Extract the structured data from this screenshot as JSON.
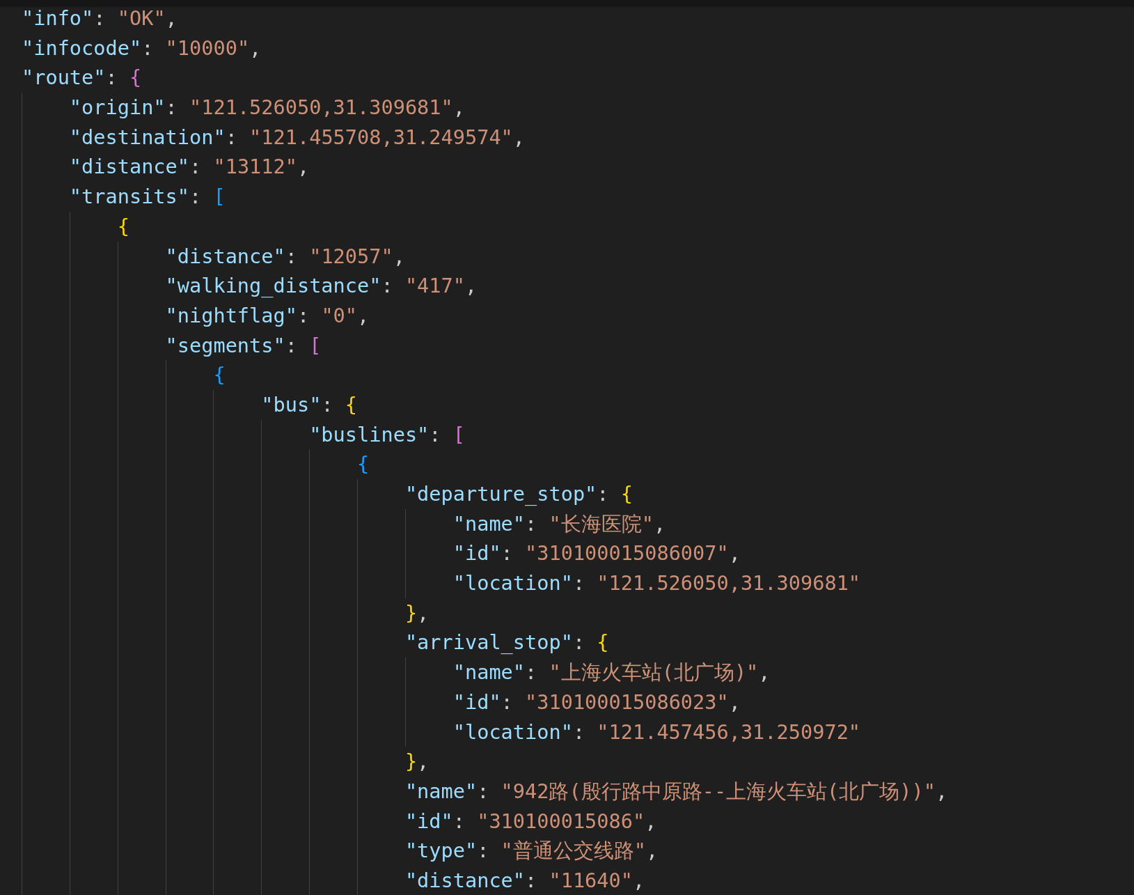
{
  "editor": {
    "lines": [
      {
        "tokens": [
          {
            "kind": "key",
            "text": "\"info\""
          },
          {
            "kind": "punct",
            "text": ": "
          },
          {
            "kind": "string",
            "text": "\"OK\""
          },
          {
            "kind": "punct",
            "text": ","
          }
        ]
      },
      {
        "tokens": [
          {
            "kind": "key",
            "text": "\"infocode\""
          },
          {
            "kind": "punct",
            "text": ": "
          },
          {
            "kind": "string",
            "text": "\"10000\""
          },
          {
            "kind": "punct",
            "text": ","
          }
        ]
      },
      {
        "tokens": [
          {
            "kind": "key",
            "text": "\"route\""
          },
          {
            "kind": "punct",
            "text": ": "
          },
          {
            "kind": "bracket",
            "text": "{",
            "color": "#da70d6"
          }
        ],
        "children": [
          {
            "tokens": [
              {
                "kind": "key",
                "text": "\"origin\""
              },
              {
                "kind": "punct",
                "text": ": "
              },
              {
                "kind": "string",
                "text": "\"121.526050,31.309681\""
              },
              {
                "kind": "punct",
                "text": ","
              }
            ]
          },
          {
            "tokens": [
              {
                "kind": "key",
                "text": "\"destination\""
              },
              {
                "kind": "punct",
                "text": ": "
              },
              {
                "kind": "string",
                "text": "\"121.455708,31.249574\""
              },
              {
                "kind": "punct",
                "text": ","
              }
            ]
          },
          {
            "tokens": [
              {
                "kind": "key",
                "text": "\"distance\""
              },
              {
                "kind": "punct",
                "text": ": "
              },
              {
                "kind": "string",
                "text": "\"13112\""
              },
              {
                "kind": "punct",
                "text": ","
              }
            ]
          },
          {
            "tokens": [
              {
                "kind": "key",
                "text": "\"transits\""
              },
              {
                "kind": "punct",
                "text": ": "
              },
              {
                "kind": "bracket",
                "text": "[",
                "color": "#179fff"
              }
            ],
            "children": [
              {
                "tokens": [
                  {
                    "kind": "bracket",
                    "text": "{",
                    "color": "#ffd700"
                  }
                ],
                "children": [
                  {
                    "tokens": [
                      {
                        "kind": "key",
                        "text": "\"distance\""
                      },
                      {
                        "kind": "punct",
                        "text": ": "
                      },
                      {
                        "kind": "string",
                        "text": "\"12057\""
                      },
                      {
                        "kind": "punct",
                        "text": ","
                      }
                    ]
                  },
                  {
                    "tokens": [
                      {
                        "kind": "key",
                        "text": "\"walking_distance\""
                      },
                      {
                        "kind": "punct",
                        "text": ": "
                      },
                      {
                        "kind": "string",
                        "text": "\"417\""
                      },
                      {
                        "kind": "punct",
                        "text": ","
                      }
                    ]
                  },
                  {
                    "tokens": [
                      {
                        "kind": "key",
                        "text": "\"nightflag\""
                      },
                      {
                        "kind": "punct",
                        "text": ": "
                      },
                      {
                        "kind": "string",
                        "text": "\"0\""
                      },
                      {
                        "kind": "punct",
                        "text": ","
                      }
                    ]
                  },
                  {
                    "tokens": [
                      {
                        "kind": "key",
                        "text": "\"segments\""
                      },
                      {
                        "kind": "punct",
                        "text": ": "
                      },
                      {
                        "kind": "bracket",
                        "text": "[",
                        "color": "#da70d6"
                      }
                    ],
                    "children": [
                      {
                        "tokens": [
                          {
                            "kind": "bracket",
                            "text": "{",
                            "color": "#179fff"
                          }
                        ],
                        "children": [
                          {
                            "tokens": [
                              {
                                "kind": "key",
                                "text": "\"bus\""
                              },
                              {
                                "kind": "punct",
                                "text": ": "
                              },
                              {
                                "kind": "bracket",
                                "text": "{",
                                "color": "#ffd700"
                              }
                            ],
                            "children": [
                              {
                                "tokens": [
                                  {
                                    "kind": "key",
                                    "text": "\"buslines\""
                                  },
                                  {
                                    "kind": "punct",
                                    "text": ": "
                                  },
                                  {
                                    "kind": "bracket",
                                    "text": "[",
                                    "color": "#da70d6"
                                  }
                                ],
                                "children": [
                                  {
                                    "tokens": [
                                      {
                                        "kind": "bracket",
                                        "text": "{",
                                        "color": "#179fff"
                                      }
                                    ],
                                    "children": [
                                      {
                                        "tokens": [
                                          {
                                            "kind": "key",
                                            "text": "\"departure_stop\""
                                          },
                                          {
                                            "kind": "punct",
                                            "text": ": "
                                          },
                                          {
                                            "kind": "bracket",
                                            "text": "{",
                                            "color": "#ffd700"
                                          }
                                        ],
                                        "children": [
                                          {
                                            "tokens": [
                                              {
                                                "kind": "key",
                                                "text": "\"name\""
                                              },
                                              {
                                                "kind": "punct",
                                                "text": ": "
                                              },
                                              {
                                                "kind": "string",
                                                "text": "\"长海医院\""
                                              },
                                              {
                                                "kind": "punct",
                                                "text": ","
                                              }
                                            ]
                                          },
                                          {
                                            "tokens": [
                                              {
                                                "kind": "key",
                                                "text": "\"id\""
                                              },
                                              {
                                                "kind": "punct",
                                                "text": ": "
                                              },
                                              {
                                                "kind": "string",
                                                "text": "\"310100015086007\""
                                              },
                                              {
                                                "kind": "punct",
                                                "text": ","
                                              }
                                            ]
                                          },
                                          {
                                            "tokens": [
                                              {
                                                "kind": "key",
                                                "text": "\"location\""
                                              },
                                              {
                                                "kind": "punct",
                                                "text": ": "
                                              },
                                              {
                                                "kind": "string",
                                                "text": "\"121.526050,31.309681\""
                                              }
                                            ]
                                          }
                                        ]
                                      },
                                      {
                                        "tokens": [
                                          {
                                            "kind": "bracket",
                                            "text": "}",
                                            "color": "#ffd700"
                                          },
                                          {
                                            "kind": "punct",
                                            "text": ","
                                          }
                                        ]
                                      },
                                      {
                                        "tokens": [
                                          {
                                            "kind": "key",
                                            "text": "\"arrival_stop\""
                                          },
                                          {
                                            "kind": "punct",
                                            "text": ": "
                                          },
                                          {
                                            "kind": "bracket",
                                            "text": "{",
                                            "color": "#ffd700"
                                          }
                                        ],
                                        "children": [
                                          {
                                            "tokens": [
                                              {
                                                "kind": "key",
                                                "text": "\"name\""
                                              },
                                              {
                                                "kind": "punct",
                                                "text": ": "
                                              },
                                              {
                                                "kind": "string",
                                                "text": "\"上海火车站(北广场)\""
                                              },
                                              {
                                                "kind": "punct",
                                                "text": ","
                                              }
                                            ]
                                          },
                                          {
                                            "tokens": [
                                              {
                                                "kind": "key",
                                                "text": "\"id\""
                                              },
                                              {
                                                "kind": "punct",
                                                "text": ": "
                                              },
                                              {
                                                "kind": "string",
                                                "text": "\"310100015086023\""
                                              },
                                              {
                                                "kind": "punct",
                                                "text": ","
                                              }
                                            ]
                                          },
                                          {
                                            "tokens": [
                                              {
                                                "kind": "key",
                                                "text": "\"location\""
                                              },
                                              {
                                                "kind": "punct",
                                                "text": ": "
                                              },
                                              {
                                                "kind": "string",
                                                "text": "\"121.457456,31.250972\""
                                              }
                                            ]
                                          }
                                        ]
                                      },
                                      {
                                        "tokens": [
                                          {
                                            "kind": "bracket",
                                            "text": "}",
                                            "color": "#ffd700"
                                          },
                                          {
                                            "kind": "punct",
                                            "text": ","
                                          }
                                        ]
                                      },
                                      {
                                        "tokens": [
                                          {
                                            "kind": "key",
                                            "text": "\"name\""
                                          },
                                          {
                                            "kind": "punct",
                                            "text": ": "
                                          },
                                          {
                                            "kind": "string",
                                            "text": "\"942路(殷行路中原路--上海火车站(北广场))\""
                                          },
                                          {
                                            "kind": "punct",
                                            "text": ","
                                          }
                                        ]
                                      },
                                      {
                                        "tokens": [
                                          {
                                            "kind": "key",
                                            "text": "\"id\""
                                          },
                                          {
                                            "kind": "punct",
                                            "text": ": "
                                          },
                                          {
                                            "kind": "string",
                                            "text": "\"310100015086\""
                                          },
                                          {
                                            "kind": "punct",
                                            "text": ","
                                          }
                                        ]
                                      },
                                      {
                                        "tokens": [
                                          {
                                            "kind": "key",
                                            "text": "\"type\""
                                          },
                                          {
                                            "kind": "punct",
                                            "text": ": "
                                          },
                                          {
                                            "kind": "string",
                                            "text": "\"普通公交线路\""
                                          },
                                          {
                                            "kind": "punct",
                                            "text": ","
                                          }
                                        ]
                                      },
                                      {
                                        "tokens": [
                                          {
                                            "kind": "key",
                                            "text": "\"distance\""
                                          },
                                          {
                                            "kind": "punct",
                                            "text": ": "
                                          },
                                          {
                                            "kind": "string",
                                            "text": "\"11640\""
                                          },
                                          {
                                            "kind": "punct",
                                            "text": ","
                                          }
                                        ]
                                      }
                                    ]
                                  }
                                ]
                              }
                            ]
                          }
                        ]
                      }
                    ]
                  }
                ]
              }
            ]
          }
        ]
      }
    ]
  }
}
